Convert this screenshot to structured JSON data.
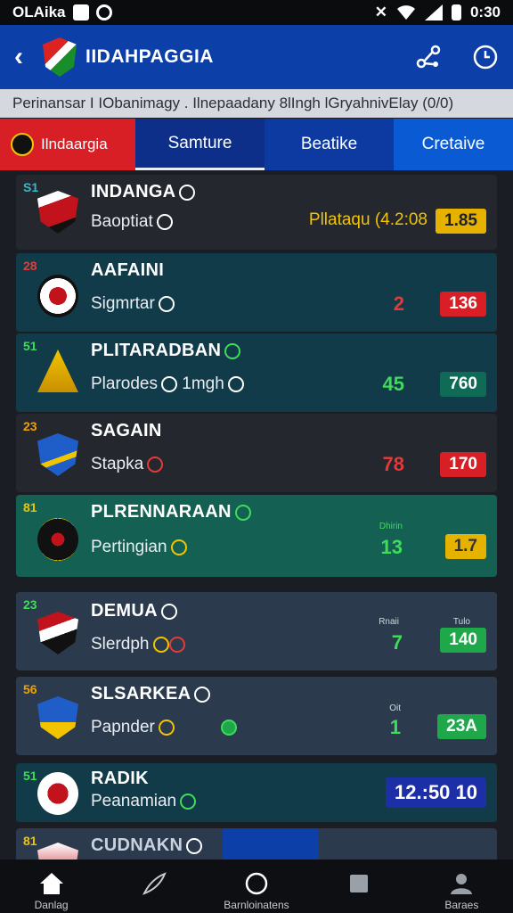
{
  "status": {
    "carrier": "OLAika",
    "time": "0:30"
  },
  "appbar": {
    "title": "IIDAHPAGGIA"
  },
  "subheader": {
    "text": "Perinansar I IObanimagy . Ilnepaadany 8lIngh lGryahnivElay (0/0)"
  },
  "tabs": [
    {
      "label": "Ilndaargia"
    },
    {
      "label": "Samture"
    },
    {
      "label": "Beatike"
    },
    {
      "label": "Cretaive"
    }
  ],
  "colors": {
    "accent_blue": "#0c3fa8",
    "red": "#d81f26",
    "green_score": "#3ddc5a",
    "yellow_badge": "#e6b200"
  },
  "rows": [
    {
      "rank": "S1",
      "name": "INDANGA",
      "sub": "Baoptiat",
      "score": "Pllataqu (4.2:08",
      "badge": "1.85"
    },
    {
      "rank": "28",
      "name": "AAFAINI",
      "sub": "Sigmrtar",
      "score": "2",
      "badge": "136"
    },
    {
      "rank": "51",
      "name": "PLITARADBAN",
      "sub": "Plarodes",
      "sub_extra": "1mgh",
      "score": "45",
      "badge": "760"
    },
    {
      "rank": "23",
      "name": "SAGAIN",
      "sub": "Stapka",
      "score": "78",
      "badge": "170"
    },
    {
      "rank": "81",
      "name": "PLRENNARAAN",
      "sub": "Pertingian",
      "score_label": "Dhirin",
      "score": "13",
      "badge": "1.7"
    },
    {
      "rank": "23",
      "name": "DEMUA",
      "sub": "Slerdph",
      "score_label": "Rnaii",
      "score": "7",
      "badge_label": "Tulo",
      "badge": "140"
    },
    {
      "rank": "56",
      "name": "SLSARKEA",
      "sub": "Papnder",
      "score_label": "Oit",
      "score": "1",
      "badge": "23A"
    },
    {
      "rank": "51",
      "name": "RADIK",
      "sub": "Peanamian",
      "badge": "12.:50  10"
    },
    {
      "rank": "81",
      "name": "CUDNAKN"
    }
  ],
  "bottomnav": [
    {
      "label": "Danlag",
      "icon": "home-icon"
    },
    {
      "label": "",
      "icon": "feather-icon"
    },
    {
      "label": "Barnloinatens",
      "icon": "circle-icon"
    },
    {
      "label": "",
      "icon": "square-icon"
    },
    {
      "label": "Baraes",
      "icon": "person-icon"
    }
  ]
}
